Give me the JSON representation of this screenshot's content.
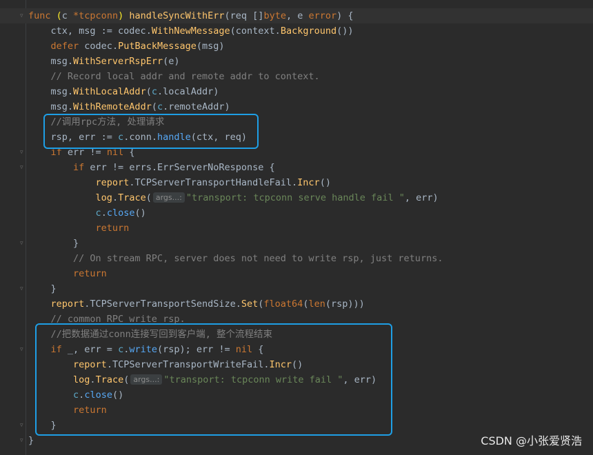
{
  "editor": {
    "lines": [
      [
        [
          "func ",
          "kw"
        ],
        [
          "(",
          "brace"
        ],
        [
          "c ",
          "pkg"
        ],
        [
          "*tcpconn",
          "kw"
        ],
        [
          ")",
          "brace"
        ],
        [
          " ",
          ""
        ],
        [
          "handleSyncWithErr",
          "fn"
        ],
        [
          "(req []",
          "pkg"
        ],
        [
          "byte",
          "kw"
        ],
        [
          ", e ",
          ""
        ],
        [
          "error",
          "kw"
        ],
        [
          ") {",
          ""
        ]
      ],
      [
        [
          "    ctx, msg := ",
          ""
        ],
        [
          "codec",
          "pkg"
        ],
        [
          ".",
          ""
        ],
        [
          "WithNewMessage",
          "fn"
        ],
        [
          "(",
          ""
        ],
        [
          "context",
          "pkg"
        ],
        [
          ".",
          ""
        ],
        [
          "Background",
          "fn"
        ],
        [
          "())",
          ""
        ]
      ],
      [
        [
          "    ",
          ""
        ],
        [
          "defer ",
          "kw"
        ],
        [
          "codec",
          ""
        ],
        [
          ".",
          ""
        ],
        [
          "PutBackMessage",
          "fn"
        ],
        [
          "(msg)",
          ""
        ]
      ],
      [
        [
          "    msg.",
          ""
        ],
        [
          "WithServerRspErr",
          "fn"
        ],
        [
          "(e)",
          ""
        ]
      ],
      [
        [
          "    // Record local addr and remote addr to context.",
          "comment"
        ]
      ],
      [
        [
          "    msg.",
          ""
        ],
        [
          "WithLocalAddr",
          "fn"
        ],
        [
          "(",
          ""
        ],
        [
          "c",
          "recv"
        ],
        [
          ".localAddr)",
          ""
        ]
      ],
      [
        [
          "    msg.",
          ""
        ],
        [
          "WithRemoteAddr",
          "fn"
        ],
        [
          "(",
          ""
        ],
        [
          "c",
          "recv"
        ],
        [
          ".remoteAddr)",
          ""
        ]
      ],
      [
        [
          "    //调用rpc方法, 处理请求",
          "cncomment"
        ]
      ],
      [
        [
          "    rsp, err := ",
          ""
        ],
        [
          "c",
          "recv"
        ],
        [
          ".conn.",
          ""
        ],
        [
          "handle",
          "call"
        ],
        [
          "(ctx, req)",
          ""
        ]
      ],
      [
        [
          "    ",
          ""
        ],
        [
          "if ",
          "kw"
        ],
        [
          "err != ",
          ""
        ],
        [
          "nil",
          "kw"
        ],
        [
          " {",
          ""
        ]
      ],
      [
        [
          "        ",
          ""
        ],
        [
          "if ",
          "kw"
        ],
        [
          "err != ",
          ""
        ],
        [
          "errs",
          "pkg"
        ],
        [
          ".ErrServerNoResponse {",
          ""
        ]
      ],
      [
        [
          "            ",
          ""
        ],
        [
          "report",
          "fn"
        ],
        [
          ".TCPServerTransportHandleFail.",
          ""
        ],
        [
          "Incr",
          "fn"
        ],
        [
          "()",
          ""
        ]
      ],
      [
        [
          "            ",
          ""
        ],
        [
          "log",
          "fn"
        ],
        [
          ".",
          ""
        ],
        [
          "Trace",
          "fn"
        ],
        [
          "(",
          ""
        ],
        [
          "args...:",
          "hint"
        ],
        [
          "\"transport: tcpconn serve handle fail \"",
          "str"
        ],
        [
          ", err)",
          ""
        ]
      ],
      [
        [
          "            ",
          ""
        ],
        [
          "c",
          "recv"
        ],
        [
          ".",
          ""
        ],
        [
          "close",
          "call"
        ],
        [
          "()",
          ""
        ]
      ],
      [
        [
          "            ",
          ""
        ],
        [
          "return",
          "kw"
        ]
      ],
      [
        [
          "        }",
          ""
        ]
      ],
      [
        [
          "        // On stream RPC, server does not need to write rsp, just returns.",
          "comment"
        ]
      ],
      [
        [
          "        ",
          ""
        ],
        [
          "return",
          "kw"
        ]
      ],
      [
        [
          "    }",
          ""
        ]
      ],
      [
        [
          "    ",
          ""
        ],
        [
          "report",
          "fn"
        ],
        [
          ".TCPServerTransportSendSize.",
          ""
        ],
        [
          "Set",
          "fn"
        ],
        [
          "(",
          ""
        ],
        [
          "float64",
          "kw"
        ],
        [
          "(",
          ""
        ],
        [
          "len",
          "kw"
        ],
        [
          "(rsp)))",
          ""
        ]
      ],
      [
        [
          "    // common RPC write rsp.",
          "comment"
        ]
      ],
      [
        [
          "    //把数据通过conn连接写回到客户端, 整个流程结束",
          "cncomment"
        ]
      ],
      [
        [
          "    ",
          ""
        ],
        [
          "if ",
          "kw"
        ],
        [
          "_, err = ",
          ""
        ],
        [
          "c",
          "recv"
        ],
        [
          ".",
          ""
        ],
        [
          "write",
          "call"
        ],
        [
          "(rsp); err != ",
          ""
        ],
        [
          "nil",
          "kw"
        ],
        [
          " {",
          ""
        ]
      ],
      [
        [
          "        ",
          ""
        ],
        [
          "report",
          "fn"
        ],
        [
          ".TCPServerTransportWriteFail.",
          ""
        ],
        [
          "Incr",
          "fn"
        ],
        [
          "()",
          ""
        ]
      ],
      [
        [
          "        ",
          ""
        ],
        [
          "log",
          "fn"
        ],
        [
          ".",
          ""
        ],
        [
          "Trace",
          "fn"
        ],
        [
          "(",
          ""
        ],
        [
          "args...:",
          "hint"
        ],
        [
          "\"transport: tcpconn write fail \"",
          "str"
        ],
        [
          ", err)",
          ""
        ]
      ],
      [
        [
          "        ",
          ""
        ],
        [
          "c",
          "recv"
        ],
        [
          ".",
          ""
        ],
        [
          "close",
          "call"
        ],
        [
          "()",
          ""
        ]
      ],
      [
        [
          "        ",
          ""
        ],
        [
          "return",
          "kw"
        ]
      ],
      [
        [
          "    }",
          ""
        ]
      ],
      [
        [
          "}",
          ""
        ]
      ]
    ]
  },
  "watermark": "CSDN @小张爱贤浩",
  "colors": {
    "highlight_box": "#1e9fe6",
    "background": "#2b2b2b"
  }
}
